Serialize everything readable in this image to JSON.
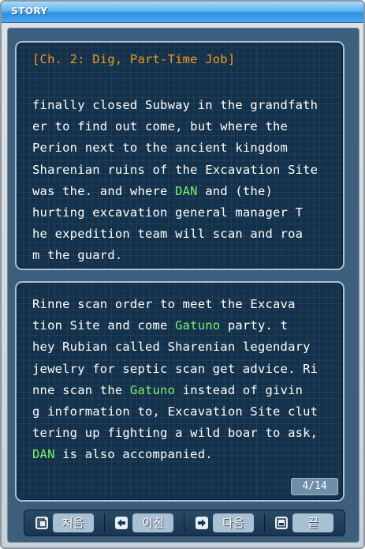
{
  "window": {
    "title": "STORY"
  },
  "story": {
    "chapter_title": "[Ch. 2: Dig, Part-Time Job]",
    "top_panel_segments": [
      {
        "text": "finally closed Subway in the grandfath\ner to find out come, but where the\nPerion next to the ancient kingdom\nSharenian ruins of the Excavation Site\nwas the.  and where ",
        "highlight": false
      },
      {
        "text": "DAN",
        "highlight": true
      },
      {
        "text": " and (the)\nhurting excavation general manager T\nhe expedition team will scan and roa\nm the guard.",
        "highlight": false
      }
    ],
    "bottom_panel_segments": [
      {
        "text": "Rinne scan order to meet the Excava\ntion Site and come ",
        "highlight": false
      },
      {
        "text": "Gatuno",
        "highlight": true
      },
      {
        "text": " party.  t\nhey Rubian called Sharenian legendary\njewelry for septic scan get advice.  Ri\nnne scan the ",
        "highlight": false
      },
      {
        "text": "Gatuno",
        "highlight": true
      },
      {
        "text": " instead of givin\ng information to, Excavation Site clut\ntering up fighting a wild boar to ask,\n",
        "highlight": false
      },
      {
        "text": "DAN",
        "highlight": true
      },
      {
        "text": " is also accompanied.",
        "highlight": false
      }
    ],
    "page_counter": "4/14"
  },
  "nav": {
    "first_label": "처음",
    "prev_label": "이전",
    "next_label": "다음",
    "end_label": "끝",
    "first_icon": "first-page-icon",
    "prev_icon": "arrow-left-icon",
    "next_icon": "arrow-right-icon",
    "end_icon": "end-page-icon"
  },
  "colors": {
    "chapter_title": "#f39a1c",
    "highlight": "#7cf06a",
    "body_text": "#ffffff",
    "panel_bg": "#13314a",
    "titlebar": "#2f8fde"
  }
}
